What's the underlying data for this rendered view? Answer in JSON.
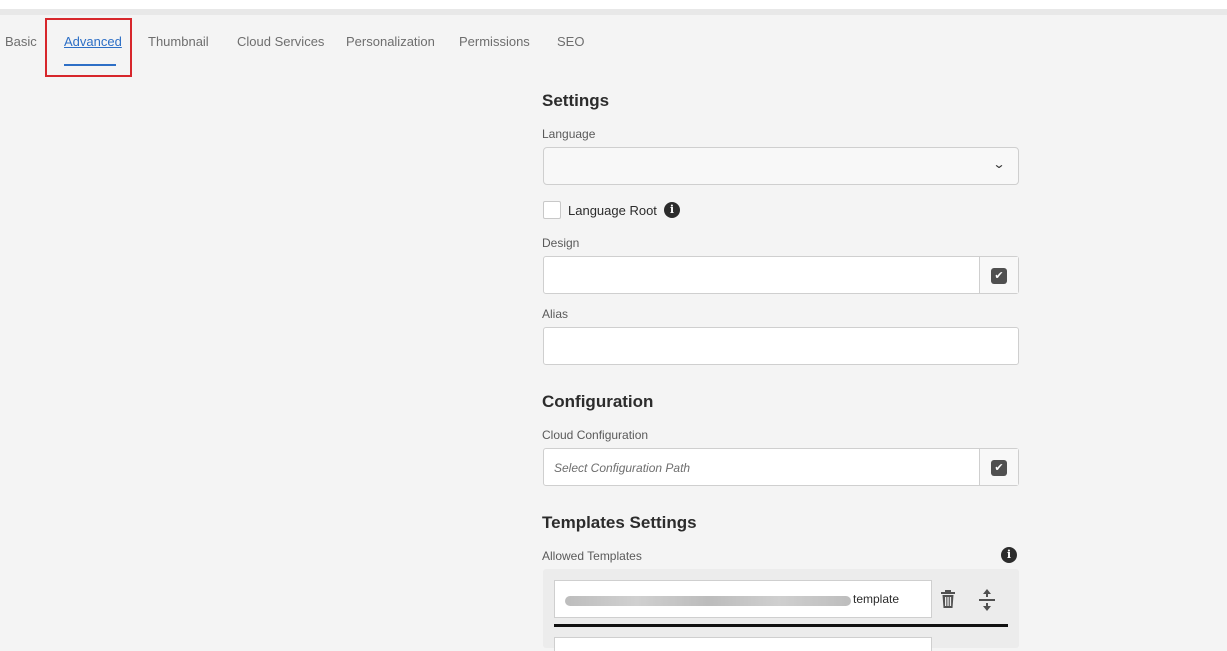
{
  "tabs": [
    {
      "label": "Basic",
      "active": false
    },
    {
      "label": "Advanced",
      "active": true
    },
    {
      "label": "Thumbnail",
      "active": false
    },
    {
      "label": "Cloud Services",
      "active": false
    },
    {
      "label": "Personalization",
      "active": false
    },
    {
      "label": "Permissions",
      "active": false
    },
    {
      "label": "SEO",
      "active": false
    }
  ],
  "settings": {
    "title": "Settings",
    "language_label": "Language",
    "language_value": "",
    "language_root_label": "Language Root",
    "language_root_checked": false,
    "design_label": "Design",
    "design_value": "",
    "alias_label": "Alias",
    "alias_value": ""
  },
  "configuration": {
    "title": "Configuration",
    "cloud_label": "Cloud Configuration",
    "cloud_placeholder": "Select Configuration Path"
  },
  "templates": {
    "title": "Templates Settings",
    "allowed_label": "Allowed Templates",
    "items": [
      {
        "value_visible": "template"
      }
    ]
  },
  "colors": {
    "accent": "#2d6fc6",
    "highlight": "#d7262b"
  },
  "icons": [
    "chevron-down-icon",
    "info-icon",
    "checkmark-icon",
    "trash-icon",
    "reorder-icon"
  ]
}
